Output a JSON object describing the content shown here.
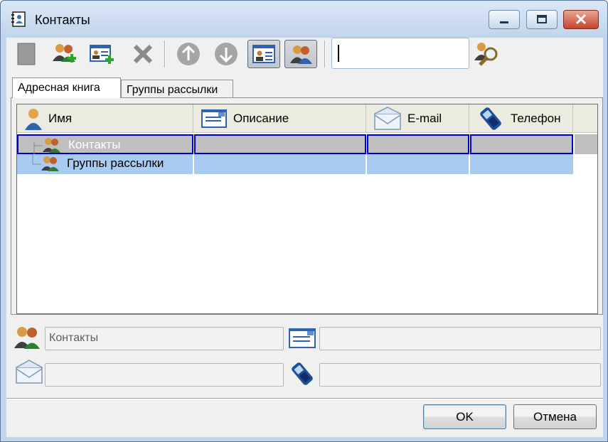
{
  "window": {
    "title": "Контакты"
  },
  "search": {
    "value": ""
  },
  "tabs": [
    {
      "label": "Адресная книга",
      "active": true
    },
    {
      "label": "Группы рассылки",
      "active": false
    }
  ],
  "grid": {
    "columns": [
      {
        "label": "Имя",
        "icon": "person-icon"
      },
      {
        "label": "Описание",
        "icon": "card-icon"
      },
      {
        "label": "E-mail",
        "icon": "envelope-icon"
      },
      {
        "label": "Телефон",
        "icon": "phone-icon"
      }
    ],
    "rows": [
      {
        "name": "Контакты",
        "description": "",
        "email": "",
        "phone": "",
        "state": "selected-focused"
      },
      {
        "name": "Группы рассылки",
        "description": "",
        "email": "",
        "phone": "",
        "state": "selected"
      }
    ]
  },
  "details": {
    "name_value": "Контакты",
    "description_value": "",
    "email_value": "",
    "phone_value": ""
  },
  "buttons": {
    "ok": "OK",
    "cancel": "Отмена"
  },
  "colors": {
    "selection": "#a7cbf1",
    "focus_border": "#0000cc",
    "focused_row": "#bfbfbf"
  }
}
